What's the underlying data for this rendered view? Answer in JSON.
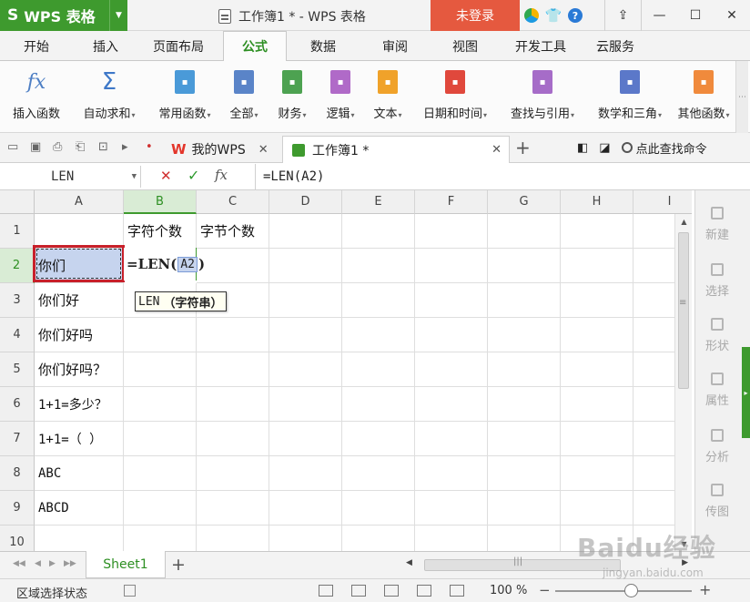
{
  "app": {
    "logo": "S",
    "name": "WPS 表格",
    "window_title": "工作簿1 * - WPS 表格",
    "login": "未登录",
    "icons": [
      "app-menu-icon",
      "skin-icon",
      "shirt-icon",
      "help-icon",
      "share-icon",
      "minimize-icon",
      "maximize-icon",
      "close-icon"
    ]
  },
  "menu_tabs": [
    {
      "label": "开始"
    },
    {
      "label": "插入"
    },
    {
      "label": "页面布局"
    },
    {
      "label": "公式",
      "active": true
    },
    {
      "label": "数据"
    },
    {
      "label": "审阅"
    },
    {
      "label": "视图"
    },
    {
      "label": "开发工具"
    },
    {
      "label": "云服务"
    }
  ],
  "ribbon": [
    {
      "label": "插入函数",
      "icon": "fx-icon",
      "dropdown": false
    },
    {
      "label": "自动求和",
      "icon": "sigma-icon",
      "dropdown": true
    },
    {
      "label": "常用函数",
      "icon": "star-book-icon",
      "dropdown": true,
      "color": "#4a9ad8"
    },
    {
      "label": "全部",
      "icon": "list-book-icon",
      "dropdown": true,
      "color": "#5a84c8"
    },
    {
      "label": "财务",
      "icon": "finance-book-icon",
      "dropdown": true,
      "color": "#4da251"
    },
    {
      "label": "逻辑",
      "icon": "question-book-icon",
      "dropdown": true,
      "color": "#b06ac8"
    },
    {
      "label": "文本",
      "icon": "text-book-icon",
      "dropdown": true,
      "color": "#f0a22a"
    },
    {
      "label": "日期和时间",
      "icon": "clock-book-icon",
      "dropdown": true,
      "color": "#e0483c"
    },
    {
      "label": "查找与引用",
      "icon": "search-book-icon",
      "dropdown": true,
      "color": "#a66cc8"
    },
    {
      "label": "数学和三角",
      "icon": "theta-book-icon",
      "dropdown": true,
      "color": "#5b78c9"
    },
    {
      "label": "其他函数",
      "icon": "more-book-icon",
      "dropdown": true,
      "color": "#f08a3c"
    }
  ],
  "doc_tabs": {
    "tab1": "我的WPS",
    "tab2": "工作簿1 *",
    "find_cmd": "点此查找命令"
  },
  "formula_bar": {
    "name_box": "LEN",
    "formula": "=LEN(A2)"
  },
  "columns": [
    "A",
    "B",
    "C",
    "D",
    "E",
    "F",
    "G",
    "H",
    "I"
  ],
  "rows": [
    "1",
    "2",
    "3",
    "4",
    "5",
    "6",
    "7",
    "8",
    "9",
    "10"
  ],
  "cells": {
    "B1": "字符个数",
    "C1": "字节个数",
    "A2": "你们",
    "A3": "你们好",
    "A4": "你们好吗",
    "A5": "你们好吗？",
    "A6": "1+1=多少？",
    "A7": "1+1=（ ）",
    "A8": "ABC",
    "A9": "ABCD"
  },
  "edit_cell": {
    "prefix": "=LEN(",
    "ref": "A2",
    "suffix": ")"
  },
  "tooltip": {
    "fn": "LEN",
    "arg": "（字符串）"
  },
  "side_panel": [
    {
      "label": "新建",
      "icon": "new-icon"
    },
    {
      "label": "选择",
      "icon": "select-icon"
    },
    {
      "label": "形状",
      "icon": "shape-icon"
    },
    {
      "label": "属性",
      "icon": "property-icon"
    },
    {
      "label": "分析",
      "icon": "analyze-icon"
    },
    {
      "label": "传图",
      "icon": "upload-image-icon"
    }
  ],
  "sheet": {
    "name": "Sheet1"
  },
  "status": {
    "mode": "区域选择状态",
    "zoom": "100 %"
  },
  "watermark": {
    "main": "Baidu经验",
    "sub": "jingyan.baidu.com"
  }
}
